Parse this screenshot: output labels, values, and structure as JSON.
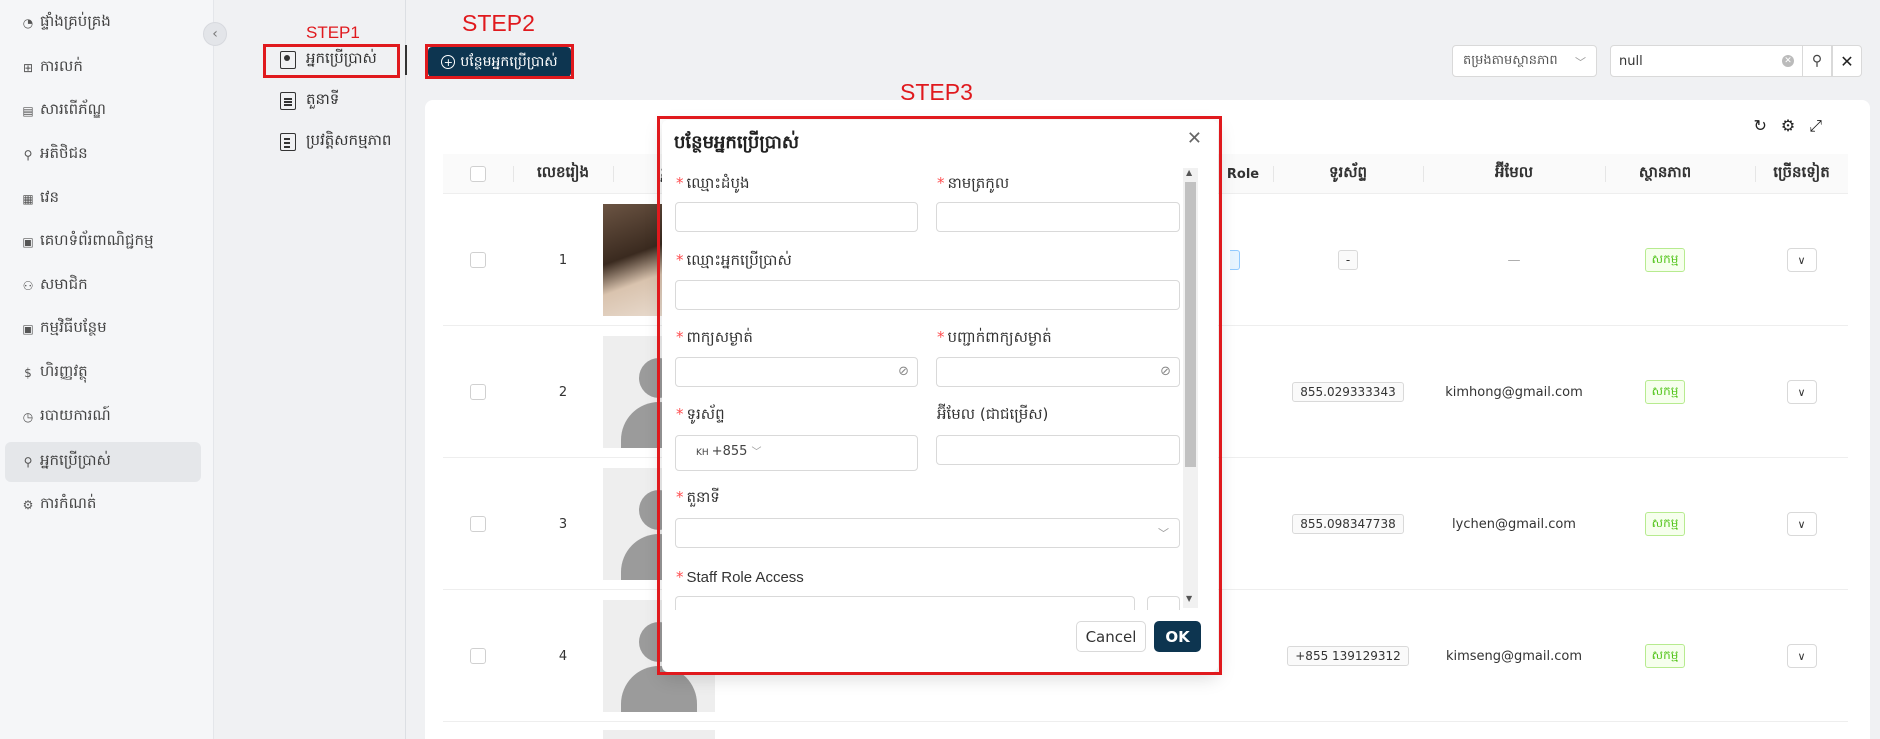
{
  "sidebar": {
    "items": [
      {
        "label": "ផ្ទាំងគ្រប់គ្រង",
        "icon": "dashboard-icon"
      },
      {
        "label": "ការលក់",
        "icon": "cart-icon"
      },
      {
        "label": "សារពើភ័ណ្ឌ",
        "icon": "inventory-icon"
      },
      {
        "label": "អតិថិជន",
        "icon": "customer-icon"
      },
      {
        "label": "វេន",
        "icon": "shift-icon"
      },
      {
        "label": "គេហទំព័រពាណិជ្ជកម្ម",
        "icon": "store-icon"
      },
      {
        "label": "សមាជិក",
        "icon": "members-icon"
      },
      {
        "label": "កម្មវិធីបន្ថែម",
        "icon": "addon-icon"
      },
      {
        "label": "ហិរញ្ញវត្ថុ",
        "icon": "finance-icon"
      },
      {
        "label": "របាយការណ៍",
        "icon": "report-icon"
      },
      {
        "label": "អ្នកប្រើប្រាស់",
        "icon": "user-icon"
      },
      {
        "label": "ការកំណត់",
        "icon": "settings-icon"
      }
    ]
  },
  "subnav": {
    "items": [
      {
        "label": "អ្នកប្រើប្រាស់",
        "icon": "user-card-icon"
      },
      {
        "label": "តួនាទី",
        "icon": "role-list-icon"
      },
      {
        "label": "ប្រវត្តិសកម្មភាព",
        "icon": "activity-log-icon"
      }
    ]
  },
  "steps": {
    "step1": "STEP1",
    "step2": "STEP2",
    "step3": "STEP3"
  },
  "toolbar": {
    "add_label": "បន្ថែមអ្នកប្រើប្រាស់",
    "filter_label": "តម្រងតាមស្ថានភាព",
    "search_value": "null"
  },
  "table": {
    "headers": {
      "no": "លេខរៀង",
      "photo": "រូបភ",
      "role": "Role",
      "phone": "ទូរស័ព្ទ",
      "email": "អ៊ីមែល",
      "status": "ស្ថានភាព",
      "more": "ច្រើនទៀត"
    },
    "rows": [
      {
        "no": "1",
        "phone": "-",
        "email": "—",
        "status": "សកម្ម"
      },
      {
        "no": "2",
        "phone": "855.029333343",
        "email": "kimhong@gmail.com",
        "status": "សកម្ម"
      },
      {
        "no": "3",
        "phone": "855.098347738",
        "email": "lychen@gmail.com",
        "status": "សកម្ម"
      },
      {
        "no": "4",
        "phone": "+855 139129312",
        "email": "kimseng@gmail.com",
        "status": "សកម្ម"
      }
    ]
  },
  "modal": {
    "title": "បន្ថែមអ្នកប្រើប្រាស់",
    "first_name": "ឈ្មោះដំបូង",
    "last_name": "នាមត្រកូល",
    "username": "ឈ្មោះអ្នកប្រើប្រាស់",
    "password": "ពាក្យសម្ងាត់",
    "confirm_password": "បញ្ជាក់ពាក្យសម្ងាត់",
    "phone": "ទូរស័ព្ទ",
    "phone_country": "KH",
    "phone_prefix": "+855",
    "email": "អ៊ីមែល (ជាជម្រើស)",
    "role": "តួនាទី",
    "staff_role_access": "Staff Role Access",
    "cancel": "Cancel",
    "ok": "OK"
  },
  "colors": {
    "primary": "#0d3550",
    "highlight": "#e0191d",
    "success": "#52c41a"
  }
}
